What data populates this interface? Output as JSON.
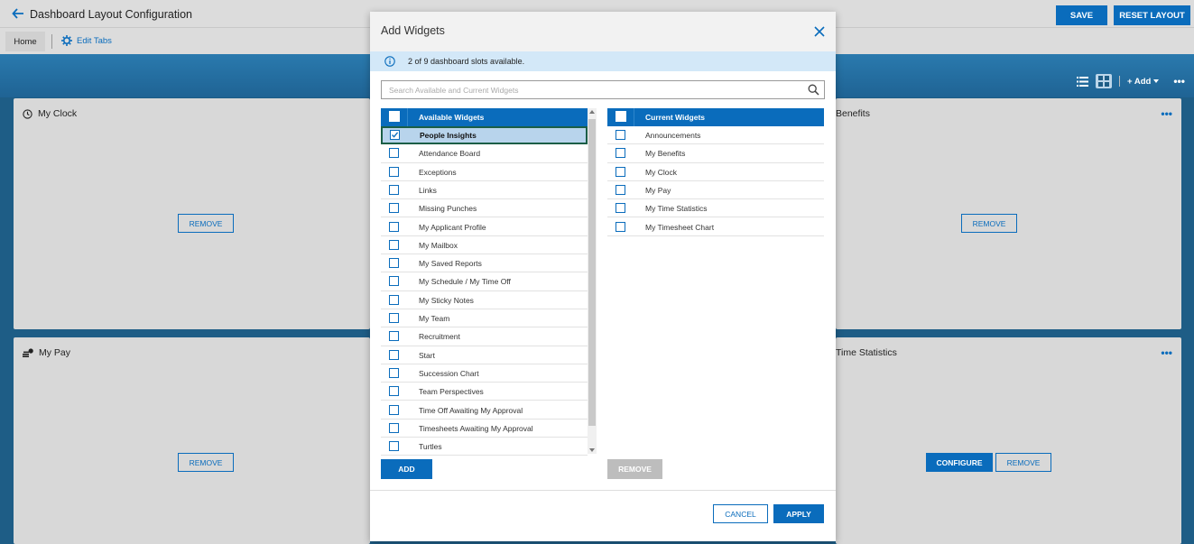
{
  "header": {
    "title": "Dashboard Layout Configuration",
    "save_label": "SAVE",
    "reset_label": "RESET LAYOUT"
  },
  "tabs": {
    "home_label": "Home",
    "edit_tabs_label": "Edit Tabs"
  },
  "toolbar": {
    "add_label": "+ Add"
  },
  "cards": {
    "my_clock": {
      "title": "My Clock",
      "remove_label": "REMOVE"
    },
    "my_benefits": {
      "title": "Benefits",
      "remove_label": "REMOVE"
    },
    "my_pay": {
      "title": "My Pay",
      "remove_label": "REMOVE"
    },
    "time_statistics": {
      "title": "Time Statistics",
      "configure_label": "CONFIGURE",
      "remove_label": "REMOVE"
    }
  },
  "modal": {
    "title": "Add Widgets",
    "info_text": "2 of 9 dashboard slots available.",
    "search_placeholder": "Search Available and Current Widgets",
    "available_header": "Available Widgets",
    "current_header": "Current Widgets",
    "available": [
      "People Insights",
      "Attendance Board",
      "Exceptions",
      "Links",
      "Missing Punches",
      "My Applicant Profile",
      "My Mailbox",
      "My Saved Reports",
      "My Schedule / My Time Off",
      "My Sticky Notes",
      "My Team",
      "Recruitment",
      "Start",
      "Succession Chart",
      "Team Perspectives",
      "Time Off Awaiting My Approval",
      "Timesheets Awaiting My Approval",
      "Turtles"
    ],
    "current": [
      "Announcements",
      "My Benefits",
      "My Clock",
      "My Pay",
      "My Time Statistics",
      "My Timesheet Chart"
    ],
    "add_label": "ADD",
    "remove_label": "REMOVE",
    "cancel_label": "CANCEL",
    "apply_label": "APPLY"
  },
  "colors": {
    "primary": "#0a6cbc",
    "info_bg": "#d3e8f8",
    "band": "#1e5d86",
    "selected_row": "#b8d4ec",
    "selected_outline": "#1b5e46"
  }
}
